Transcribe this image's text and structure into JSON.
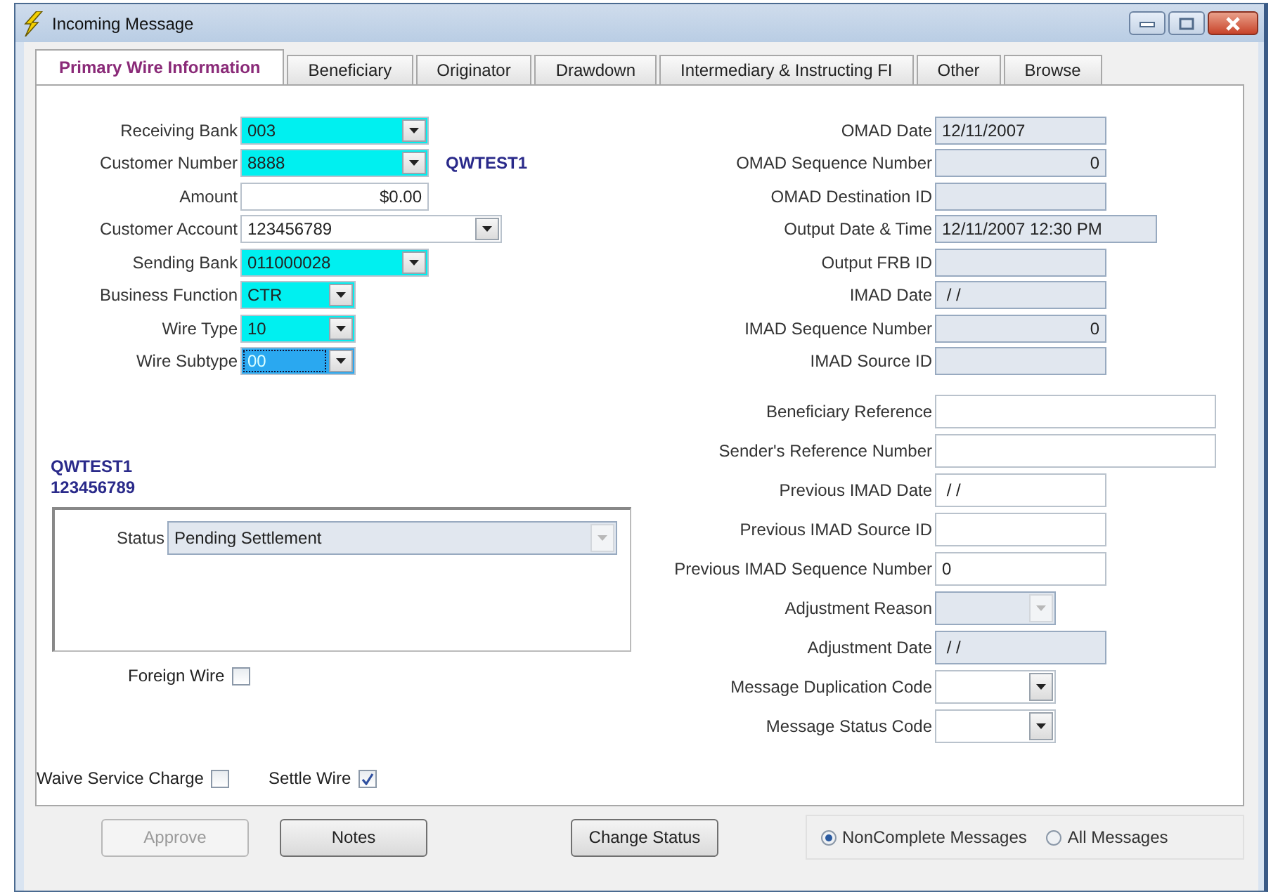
{
  "window": {
    "title": "Incoming Message"
  },
  "tabs": [
    {
      "label": "Primary Wire Information",
      "selected": true
    },
    {
      "label": "Beneficiary",
      "selected": false
    },
    {
      "label": "Originator",
      "selected": false
    },
    {
      "label": "Drawdown",
      "selected": false
    },
    {
      "label": "Intermediary & Instructing FI",
      "selected": false
    },
    {
      "label": "Other",
      "selected": false
    },
    {
      "label": "Browse",
      "selected": false
    }
  ],
  "left_fields": [
    {
      "label": "Receiving Bank",
      "value": "003",
      "kind": "combo",
      "highlighted": true,
      "readonly": false,
      "focused": false
    },
    {
      "label": "Customer Number",
      "value": "8888",
      "kind": "combo",
      "highlighted": true,
      "readonly": false,
      "focused": false,
      "note": "QWTEST1"
    },
    {
      "label": "Amount",
      "value": "$0.00",
      "kind": "number",
      "highlighted": false,
      "readonly": false,
      "focused": false
    },
    {
      "label": "Customer Account",
      "value": "123456789",
      "kind": "combo",
      "highlighted": false,
      "readonly": false,
      "focused": false
    },
    {
      "label": "Sending Bank",
      "value": "011000028",
      "kind": "combo",
      "highlighted": true,
      "readonly": false,
      "focused": false
    },
    {
      "label": "Business Function",
      "value": "CTR",
      "kind": "combo",
      "highlighted": true,
      "readonly": false,
      "focused": false
    },
    {
      "label": "Wire Type",
      "value": "10",
      "kind": "combo",
      "highlighted": true,
      "readonly": false,
      "focused": false
    },
    {
      "label": "Wire Subtype",
      "value": "00",
      "kind": "combo",
      "highlighted": true,
      "readonly": false,
      "focused": true
    }
  ],
  "customer_info": [
    "QWTEST1",
    "123456789"
  ],
  "status": {
    "label": "Status",
    "value": "Pending Settlement",
    "kind": "combo",
    "readonly": true
  },
  "foreign_wire": {
    "label": "Foreign Wire",
    "checked": false
  },
  "bottom_checks": [
    {
      "label": "Waive Service Charge",
      "checked": false
    },
    {
      "label": "Settle Wire",
      "checked": true
    }
  ],
  "right_fields": [
    {
      "label": "OMAD Date",
      "value": "12/11/2007",
      "kind": "text",
      "readonly": true
    },
    {
      "label": "OMAD Sequence Number",
      "value": "0",
      "kind": "number",
      "readonly": true
    },
    {
      "label": "OMAD Destination ID",
      "kind": "text",
      "readonly": true
    },
    {
      "label": "Output Date & Time",
      "value": "12/11/2007 12:30 PM",
      "kind": "text",
      "readonly": true
    },
    {
      "label": "Output FRB ID",
      "kind": "text",
      "readonly": true
    },
    {
      "label": "IMAD Date",
      "value": " / /",
      "kind": "text",
      "readonly": true
    },
    {
      "label": "IMAD Sequence Number",
      "value": "0",
      "kind": "number",
      "readonly": true
    },
    {
      "label": "IMAD Source ID",
      "kind": "text",
      "readonly": true
    }
  ],
  "right_fields_2": [
    {
      "label": "Beneficiary Reference",
      "kind": "text",
      "readonly": false
    },
    {
      "label": "Sender's Reference Number",
      "kind": "text",
      "readonly": false
    },
    {
      "label": "Previous IMAD Date",
      "value": " / /",
      "kind": "text",
      "readonly": false
    },
    {
      "label": "Previous IMAD Source ID",
      "kind": "text",
      "readonly": false
    },
    {
      "label": "Previous IMAD Sequence Number",
      "value": "0",
      "kind": "text",
      "readonly": false
    },
    {
      "label": "Adjustment Reason",
      "kind": "combo",
      "readonly": true
    },
    {
      "label": "Adjustment Date",
      "value": " / /",
      "kind": "text",
      "readonly": true
    },
    {
      "label": "Message Duplication Code",
      "kind": "combo",
      "readonly": false
    },
    {
      "label": "Message Status Code",
      "kind": "combo",
      "readonly": false
    }
  ],
  "buttons": [
    {
      "label": "Approve",
      "disabled": true
    },
    {
      "label": "Notes",
      "disabled": false
    },
    {
      "label": "Change Status",
      "disabled": false
    }
  ],
  "message_filter": [
    {
      "label": "NonComplete Messages",
      "selected": true
    },
    {
      "label": "All Messages",
      "selected": false
    }
  ]
}
